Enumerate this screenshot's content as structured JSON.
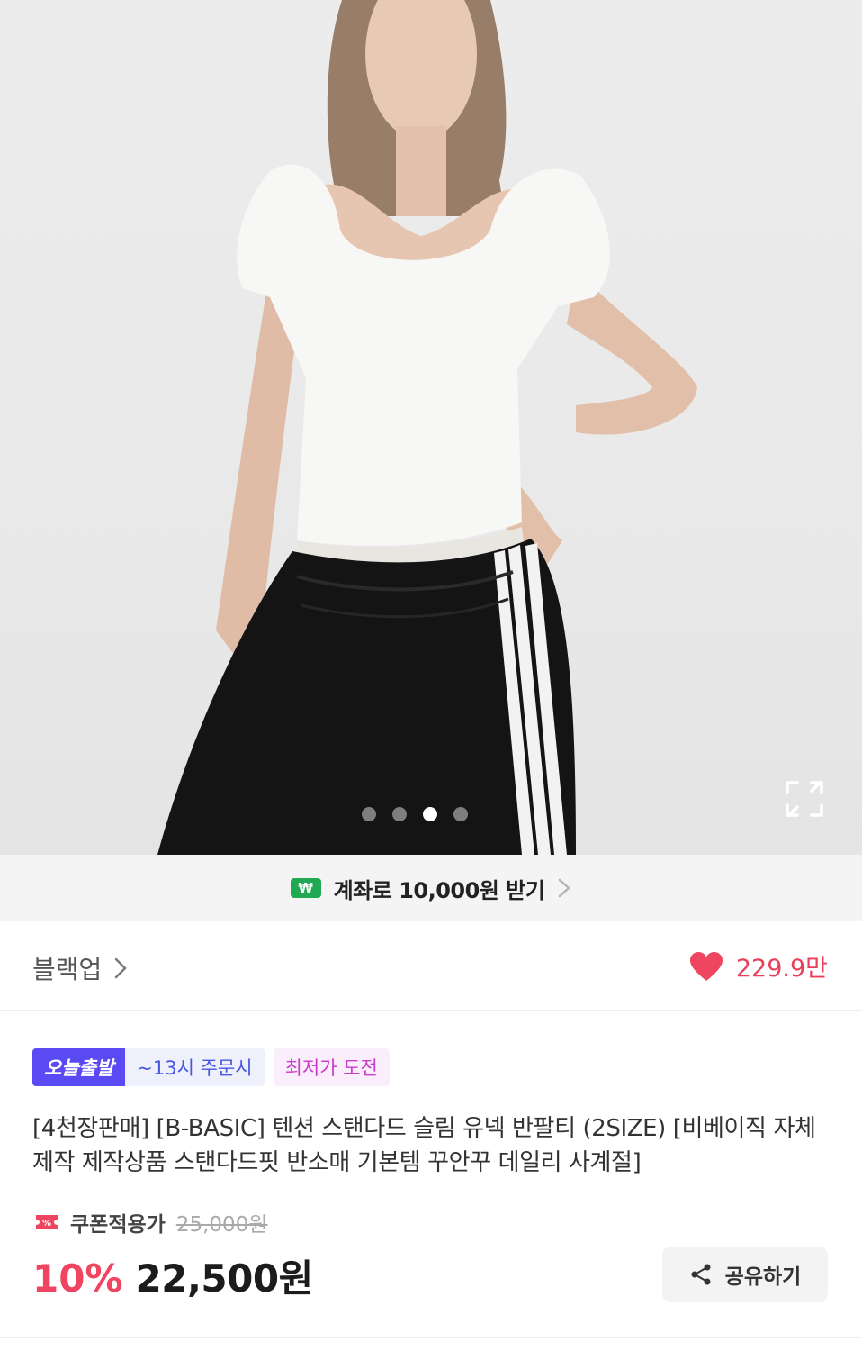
{
  "carousel": {
    "dot_count": 4,
    "active_index": 2,
    "expand_icon": "expand-icon"
  },
  "promo": {
    "badge": "₩",
    "text": "계좌로 10,000원 받기",
    "icon": "chevron-right-icon",
    "badge_color": "#1fa953"
  },
  "brand": {
    "name": "블랙업",
    "likes": "229.9만",
    "heart_color": "#f04561"
  },
  "tags": {
    "today": "오늘출발",
    "cutoff": "~13시 주문시",
    "lowest": "최저가 도전"
  },
  "product": {
    "title": "[4천장판매] [B-BASIC] 텐션 스탠다드 슬림 유넥 반팔티 (2SIZE) [비베이직 자체제작 제작상품 스탠다드핏 반소매 기본템 꾸안꾸 데일리 사계절]"
  },
  "price": {
    "coupon_label": "쿠폰적용가",
    "original": "25,000원",
    "discount": "10%",
    "final": "22,500원",
    "discount_color": "#f04561"
  },
  "share": {
    "label": "공유하기"
  }
}
